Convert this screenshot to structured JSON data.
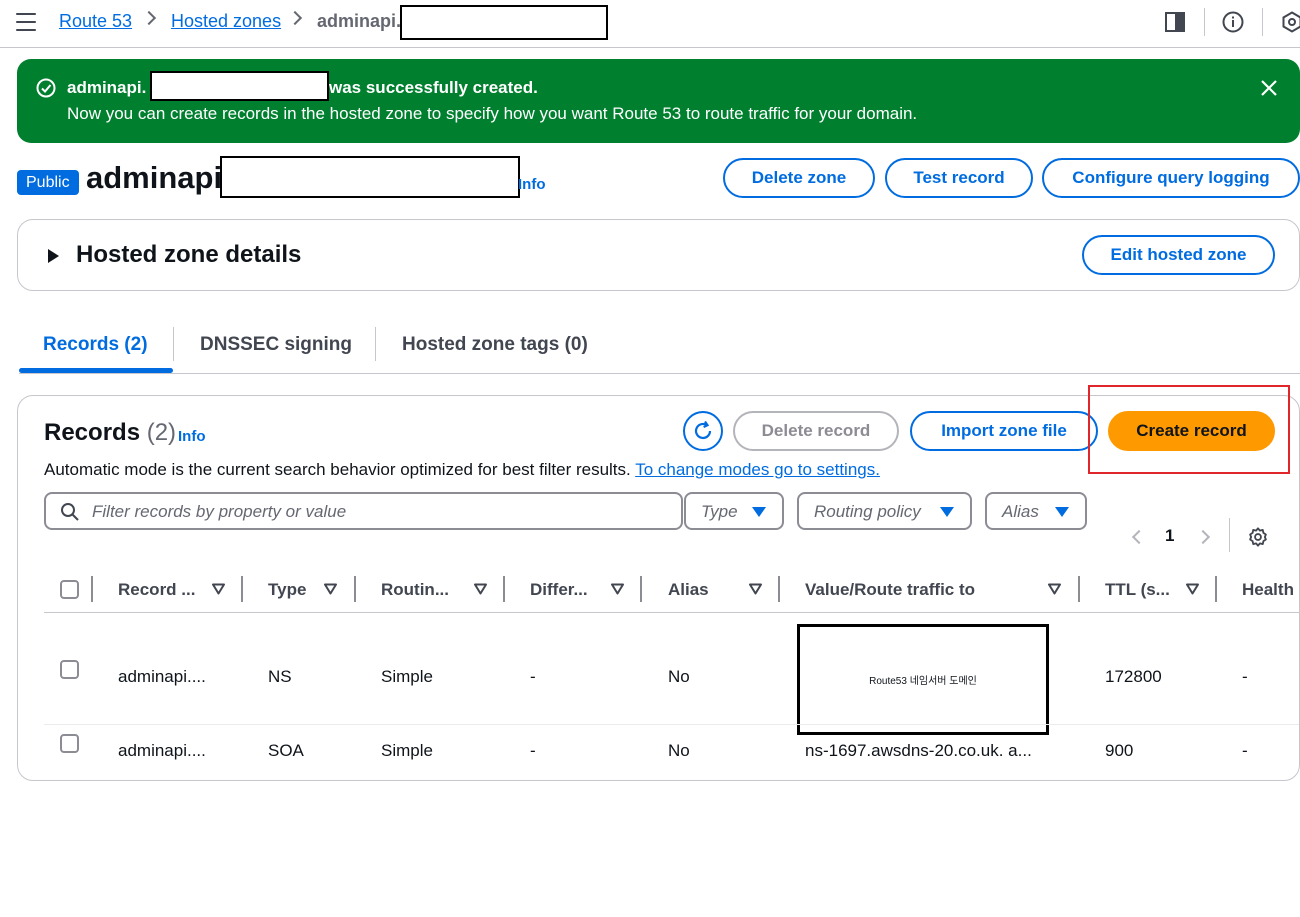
{
  "breadcrumb": {
    "items": [
      "Route 53",
      "Hosted zones"
    ],
    "current": "adminapi."
  },
  "flash": {
    "title_prefix": "adminapi.",
    "title_suffix": "was successfully created.",
    "body": "Now you can create records in the hosted zone to specify how you want Route 53 to route traffic for your domain."
  },
  "header": {
    "badge": "Public",
    "title": "adminapi.",
    "info": "Info",
    "buttons": {
      "delete_zone": "Delete zone",
      "test_record": "Test record",
      "configure_logging": "Configure query logging"
    }
  },
  "details": {
    "title": "Hosted zone details",
    "edit_button": "Edit hosted zone"
  },
  "tabs": [
    "Records (2)",
    "DNSSEC signing",
    "Hosted zone tags (0)"
  ],
  "records_panel": {
    "title": "Records",
    "count": "(2)",
    "info": "Info",
    "buttons": {
      "delete": "Delete record",
      "import": "Import zone file",
      "create": "Create record"
    },
    "mode_text": "Automatic mode is the current search behavior optimized for best filter results.",
    "mode_link": "To change modes go to settings.",
    "search_placeholder": "Filter records by property or value",
    "filters": [
      "Type",
      "Routing policy",
      "Alias"
    ],
    "page": "1"
  },
  "table": {
    "columns": [
      "Record ...",
      "Type",
      "Routin...",
      "Differ...",
      "Alias",
      "Value/Route traffic to",
      "TTL (s...",
      "Health"
    ],
    "rows": [
      [
        "adminapi....",
        "NS",
        "Simple",
        "-",
        "No",
        "Route53 네임서버 도메인",
        "172800",
        "-"
      ],
      [
        "adminapi....",
        "SOA",
        "Simple",
        "-",
        "No",
        "ns-1697.awsdns-20.co.uk. a...",
        "900",
        "-"
      ]
    ]
  },
  "colors": {
    "accent": "#006ce0",
    "success": "#00802f",
    "primary_button": "#ff9900",
    "highlight": "#e0262a"
  }
}
